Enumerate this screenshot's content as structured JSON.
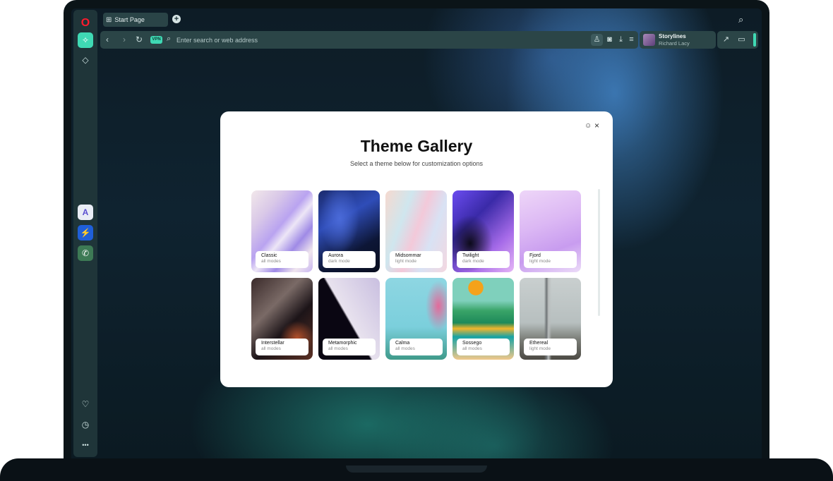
{
  "browser": {
    "tab": {
      "label": "Start Page"
    },
    "address_bar": {
      "placeholder": "Enter search or web address",
      "vpn_label": "VPN"
    },
    "player": {
      "title": "Storylines",
      "artist": "Richard Lacy"
    },
    "accent_color": "#3fd9b4"
  },
  "sidebar": {
    "items": [
      {
        "name": "opera-logo",
        "glyph": "O"
      },
      {
        "name": "aria",
        "glyph": "✧"
      },
      {
        "name": "pinboard",
        "glyph": "◇"
      },
      {
        "name": "app-1",
        "glyph": "A"
      },
      {
        "name": "messenger",
        "glyph": "⚡"
      },
      {
        "name": "whatsapp",
        "glyph": "✆"
      },
      {
        "name": "favorites",
        "glyph": "♡"
      },
      {
        "name": "history",
        "glyph": "◷"
      },
      {
        "name": "more",
        "glyph": "•••"
      }
    ]
  },
  "modal": {
    "title": "Theme Gallery",
    "subtitle": "Select a theme below for customization options",
    "themes": [
      {
        "name": "Classic",
        "mode": "all modes"
      },
      {
        "name": "Aurora",
        "mode": "dark mode"
      },
      {
        "name": "Midsommar",
        "mode": "light mode"
      },
      {
        "name": "Twilight",
        "mode": "dark mode"
      },
      {
        "name": "Fjord",
        "mode": "light mode"
      },
      {
        "name": "Interstellar",
        "mode": "all modes"
      },
      {
        "name": "Metamorphic",
        "mode": "all modes"
      },
      {
        "name": "Calma",
        "mode": "all modes"
      },
      {
        "name": "Sossego",
        "mode": "all modes"
      },
      {
        "name": "Ethereal",
        "mode": "light mode"
      }
    ]
  }
}
